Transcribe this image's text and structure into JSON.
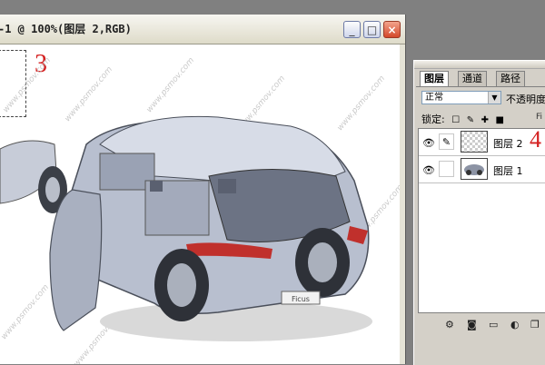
{
  "document": {
    "title": "-1 @ 100%(图层 2,RGB)",
    "buttons": {
      "minimize": "_",
      "maximize": "□",
      "close": "×"
    },
    "annotation": "3",
    "watermark": "www.psmov.com",
    "badge_text": "Ficus"
  },
  "layers_panel": {
    "tabs": [
      {
        "label": "图层",
        "active": true
      },
      {
        "label": "通道",
        "active": false
      },
      {
        "label": "路径",
        "active": false
      }
    ],
    "blend_mode": "正常",
    "opacity_label": "不透明度",
    "lock_label": "锁定:",
    "fill_label": "Fi",
    "layers": [
      {
        "name": "图层 2",
        "selected": true
      },
      {
        "name": "图层 1",
        "selected": false
      }
    ],
    "annotation": "4"
  },
  "colors": {
    "annotation": "#d42020",
    "panel_bg": "#d4d0c8",
    "workspace": "#808080"
  }
}
